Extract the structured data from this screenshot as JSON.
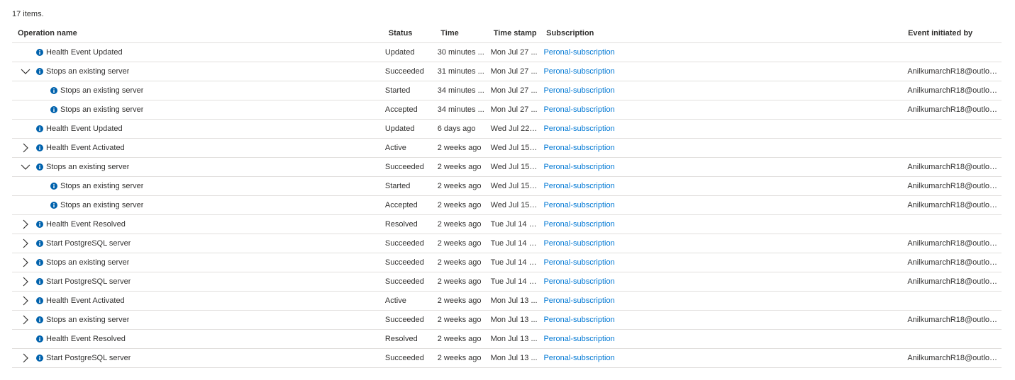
{
  "summary": "17 items.",
  "columns": {
    "operation": "Operation name",
    "status": "Status",
    "time": "Time",
    "timestamp": "Time stamp",
    "subscription": "Subscription",
    "initiated_by": "Event initiated by"
  },
  "colors": {
    "link": "#0078d4",
    "info_icon": "#0062ad",
    "divider": "#e1dfdd"
  },
  "rows": [
    {
      "operation": "Health Event Updated",
      "status": "Updated",
      "time": "30 minutes ...",
      "timestamp": "Mon Jul 27 ...",
      "subscription": "Peronal-subscription",
      "initiated_by": "",
      "expander": "none",
      "level": 0
    },
    {
      "operation": "Stops an existing server",
      "status": "Succeeded",
      "time": "31 minutes ...",
      "timestamp": "Mon Jul 27 ...",
      "subscription": "Peronal-subscription",
      "initiated_by": "AnilkumarchR18@outlook...",
      "expander": "expanded",
      "level": 0
    },
    {
      "operation": "Stops an existing server",
      "status": "Started",
      "time": "34 minutes ...",
      "timestamp": "Mon Jul 27 ...",
      "subscription": "Peronal-subscription",
      "initiated_by": "AnilkumarchR18@outlook...",
      "expander": "none",
      "level": 1
    },
    {
      "operation": "Stops an existing server",
      "status": "Accepted",
      "time": "34 minutes ...",
      "timestamp": "Mon Jul 27 ...",
      "subscription": "Peronal-subscription",
      "initiated_by": "AnilkumarchR18@outlook...",
      "expander": "none",
      "level": 1
    },
    {
      "operation": "Health Event Updated",
      "status": "Updated",
      "time": "6 days ago",
      "timestamp": "Wed Jul 22 ...",
      "subscription": "Peronal-subscription",
      "initiated_by": "",
      "expander": "none",
      "level": 0
    },
    {
      "operation": "Health Event Activated",
      "status": "Active",
      "time": "2 weeks ago",
      "timestamp": "Wed Jul 15 ...",
      "subscription": "Peronal-subscription",
      "initiated_by": "",
      "expander": "collapsed",
      "level": 0
    },
    {
      "operation": "Stops an existing server",
      "status": "Succeeded",
      "time": "2 weeks ago",
      "timestamp": "Wed Jul 15 ...",
      "subscription": "Peronal-subscription",
      "initiated_by": "AnilkumarchR18@outlook...",
      "expander": "expanded",
      "level": 0
    },
    {
      "operation": "Stops an existing server",
      "status": "Started",
      "time": "2 weeks ago",
      "timestamp": "Wed Jul 15 ...",
      "subscription": "Peronal-subscription",
      "initiated_by": "AnilkumarchR18@outlook...",
      "expander": "none",
      "level": 1
    },
    {
      "operation": "Stops an existing server",
      "status": "Accepted",
      "time": "2 weeks ago",
      "timestamp": "Wed Jul 15 ...",
      "subscription": "Peronal-subscription",
      "initiated_by": "AnilkumarchR18@outlook...",
      "expander": "none",
      "level": 1
    },
    {
      "operation": "Health Event Resolved",
      "status": "Resolved",
      "time": "2 weeks ago",
      "timestamp": "Tue Jul 14 2...",
      "subscription": "Peronal-subscription",
      "initiated_by": "",
      "expander": "collapsed",
      "level": 0
    },
    {
      "operation": "Start PostgreSQL server",
      "status": "Succeeded",
      "time": "2 weeks ago",
      "timestamp": "Tue Jul 14 2...",
      "subscription": "Peronal-subscription",
      "initiated_by": "AnilkumarchR18@outlook...",
      "expander": "collapsed",
      "level": 0
    },
    {
      "operation": "Stops an existing server",
      "status": "Succeeded",
      "time": "2 weeks ago",
      "timestamp": "Tue Jul 14 2...",
      "subscription": "Peronal-subscription",
      "initiated_by": "AnilkumarchR18@outlook...",
      "expander": "collapsed",
      "level": 0
    },
    {
      "operation": "Start PostgreSQL server",
      "status": "Succeeded",
      "time": "2 weeks ago",
      "timestamp": "Tue Jul 14 2...",
      "subscription": "Peronal-subscription",
      "initiated_by": "AnilkumarchR18@outlook...",
      "expander": "collapsed",
      "level": 0
    },
    {
      "operation": "Health Event Activated",
      "status": "Active",
      "time": "2 weeks ago",
      "timestamp": "Mon Jul 13 ...",
      "subscription": "Peronal-subscription",
      "initiated_by": "",
      "expander": "collapsed",
      "level": 0
    },
    {
      "operation": "Stops an existing server",
      "status": "Succeeded",
      "time": "2 weeks ago",
      "timestamp": "Mon Jul 13 ...",
      "subscription": "Peronal-subscription",
      "initiated_by": "AnilkumarchR18@outlook...",
      "expander": "collapsed",
      "level": 0
    },
    {
      "operation": "Health Event Resolved",
      "status": "Resolved",
      "time": "2 weeks ago",
      "timestamp": "Mon Jul 13 ...",
      "subscription": "Peronal-subscription",
      "initiated_by": "",
      "expander": "none",
      "level": 0
    },
    {
      "operation": "Start PostgreSQL server",
      "status": "Succeeded",
      "time": "2 weeks ago",
      "timestamp": "Mon Jul 13 ...",
      "subscription": "Peronal-subscription",
      "initiated_by": "AnilkumarchR18@outlook...",
      "expander": "collapsed",
      "level": 0
    }
  ]
}
